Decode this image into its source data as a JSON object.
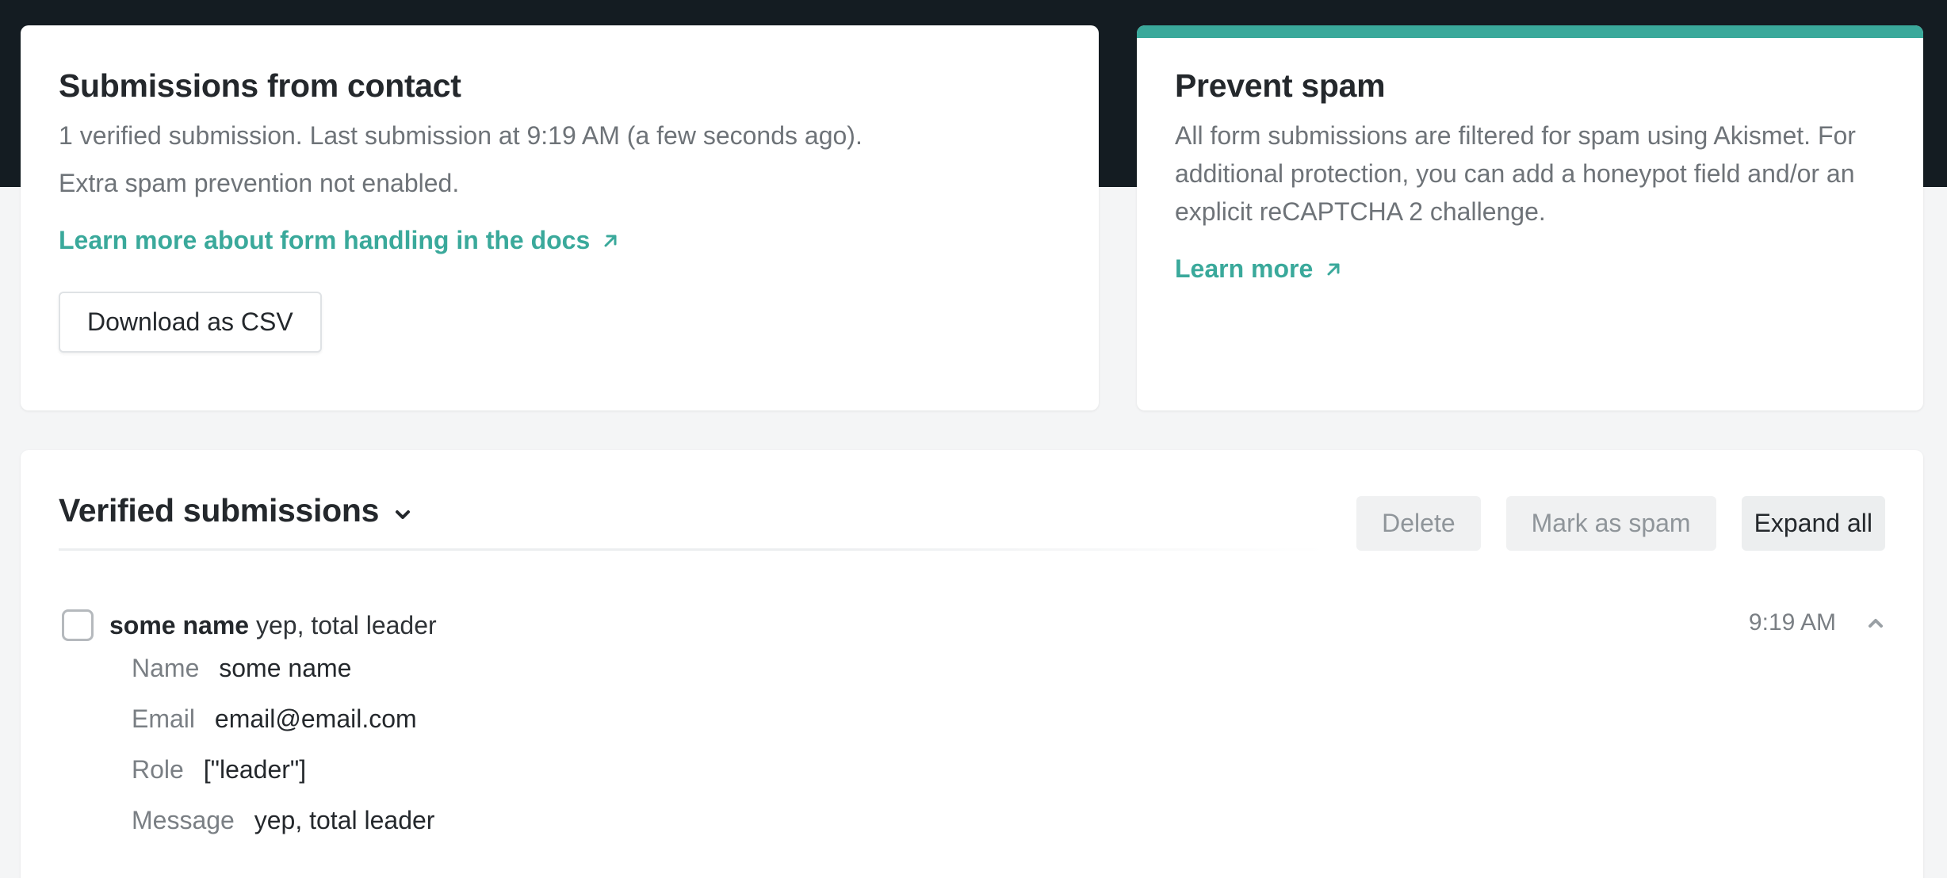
{
  "contact_card": {
    "title": "Submissions from contact",
    "summary": "1 verified submission. Last submission at 9:19 AM (a few seconds ago).",
    "spam_status": "Extra spam prevention not enabled.",
    "docs_link": "Learn more about form handling in the docs",
    "download_label": "Download as CSV"
  },
  "spam_card": {
    "title": "Prevent spam",
    "description": "All form submissions are filtered for spam using Akismet. For additional protection, you can add a honeypot field and/or an explicit reCAPTCHA 2 challenge.",
    "learn_more": "Learn more",
    "accent_color": "#3aa99b"
  },
  "verified": {
    "title": "Verified submissions",
    "actions": {
      "delete": "Delete",
      "mark_spam": "Mark as spam",
      "expand_all": "Expand all"
    },
    "submissions": [
      {
        "name_bold": "some name",
        "preview": "yep, total leader",
        "time": "9:19 AM",
        "fields": [
          {
            "label": "Name",
            "value": "some name"
          },
          {
            "label": "Email",
            "value": "email@email.com"
          },
          {
            "label": "Role",
            "value": "[\"leader\"]"
          },
          {
            "label": "Message",
            "value": "yep, total leader"
          }
        ]
      }
    ]
  },
  "icons": {
    "external": "arrow-up-right-icon",
    "dropdown": "chevron-down-icon",
    "collapse": "chevron-up-icon"
  }
}
